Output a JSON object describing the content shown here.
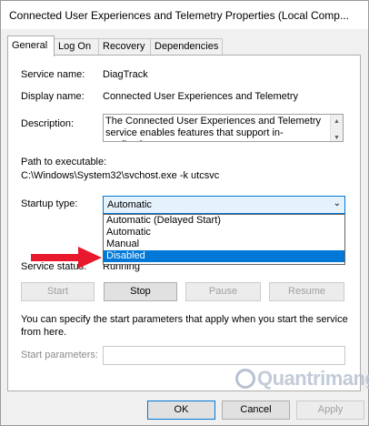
{
  "window": {
    "title": "Connected User Experiences and Telemetry Properties (Local Comp..."
  },
  "tabs": [
    {
      "label": "General",
      "active": true
    },
    {
      "label": "Log On",
      "active": false
    },
    {
      "label": "Recovery",
      "active": false
    },
    {
      "label": "Dependencies",
      "active": false
    }
  ],
  "general": {
    "service_name_label": "Service name:",
    "service_name_value": "DiagTrack",
    "display_name_label": "Display name:",
    "display_name_value": "Connected User Experiences and Telemetry",
    "description_label": "Description:",
    "description_value": "The Connected User Experiences and Telemetry service enables features that support in-application",
    "path_label": "Path to executable:",
    "path_value": "C:\\Windows\\System32\\svchost.exe -k utcsvc",
    "startup_type_label": "Startup type:",
    "startup_type_value": "Automatic",
    "startup_options": [
      "Automatic (Delayed Start)",
      "Automatic",
      "Manual",
      "Disabled"
    ],
    "startup_highlighted": "Disabled",
    "service_status_label": "Service status:",
    "service_status_value": "Running",
    "buttons": {
      "start": "Start",
      "stop": "Stop",
      "pause": "Pause",
      "resume": "Resume"
    },
    "hint_text": "You can specify the start parameters that apply when you start the service from here.",
    "start_params_label": "Start parameters:",
    "start_params_value": ""
  },
  "footer": {
    "ok": "OK",
    "cancel": "Cancel",
    "apply": "Apply"
  },
  "watermark": {
    "text": "Quantrimang"
  },
  "colors": {
    "accent": "#0078d7",
    "arrow": "#e8192c"
  },
  "icons": {
    "dropdown": "chevron-down-icon",
    "arrow": "red-arrow-icon"
  }
}
